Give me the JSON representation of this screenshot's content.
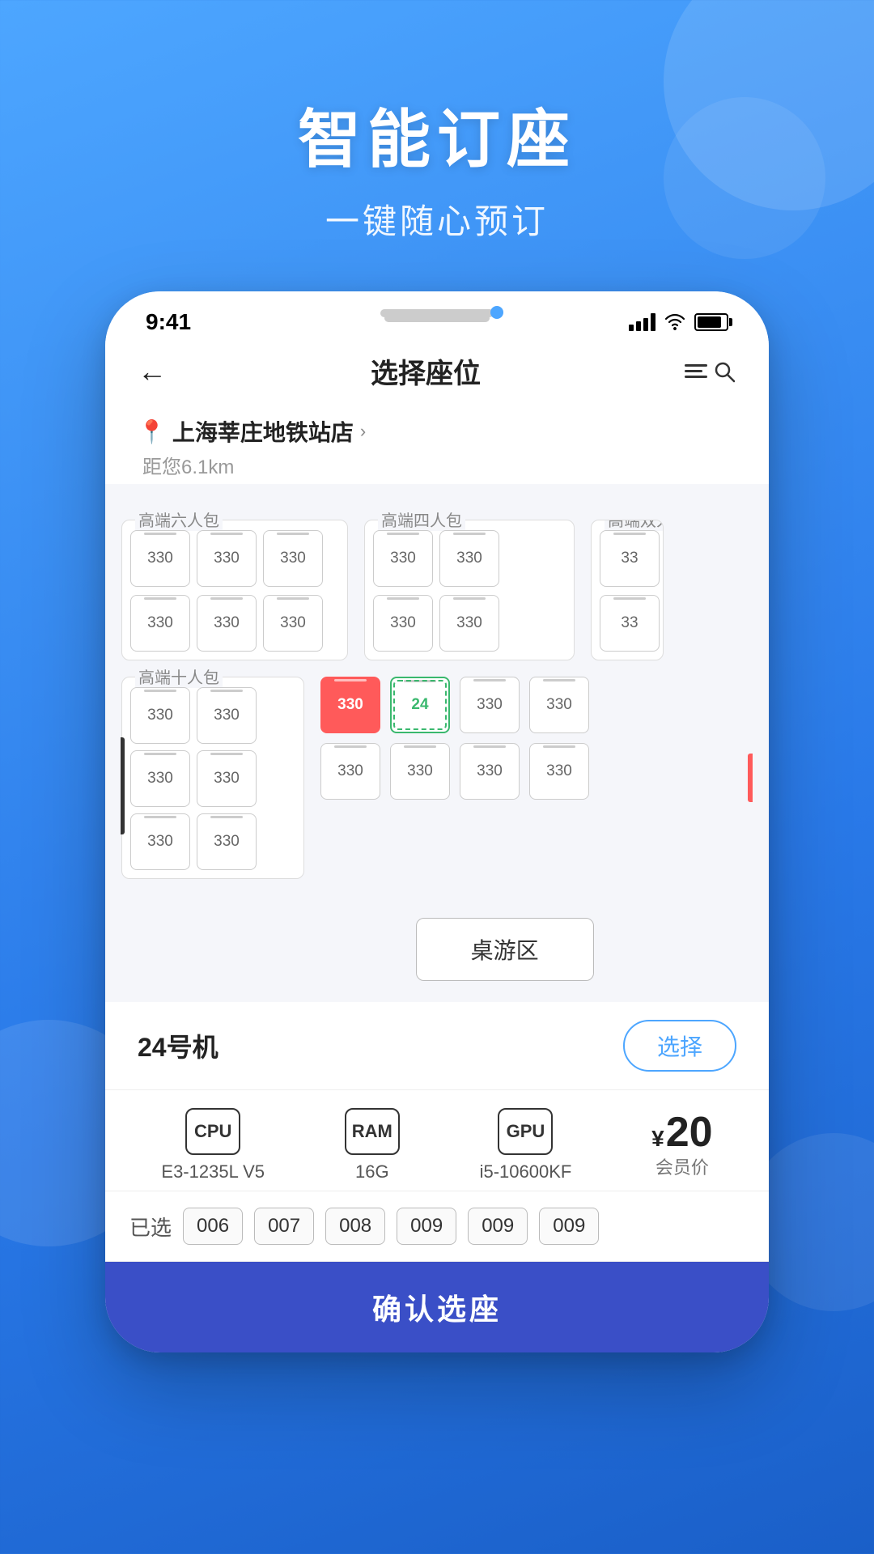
{
  "background": {
    "gradient_start": "#4da6ff",
    "gradient_end": "#1a5fc8"
  },
  "header": {
    "title": "智能订座",
    "subtitle": "一键随心预订"
  },
  "status_bar": {
    "time": "9:41",
    "signal": "4 bars",
    "wifi": "on",
    "battery": "full"
  },
  "app_bar": {
    "back_label": "←",
    "title": "选择座位",
    "filter_icon": "list-search"
  },
  "location": {
    "name": "上海莘庄地铁站店",
    "arrow": ">",
    "distance": "距您6.1km"
  },
  "seat_map": {
    "rooms": [
      {
        "id": "room-6",
        "label": "高端六人包",
        "seats": [
          "330",
          "330",
          "330",
          "330",
          "330",
          "330"
        ]
      },
      {
        "id": "room-4",
        "label": "高端四人包",
        "seats": [
          "330",
          "330",
          "330",
          "330"
        ]
      },
      {
        "id": "room-2",
        "label": "高端双人",
        "seats": [
          "33",
          "33"
        ]
      }
    ],
    "room_10": {
      "label": "高端十人包",
      "left_seats": [
        "330",
        "330",
        "330",
        "330",
        "330",
        "330"
      ],
      "right_seats_top": [
        "330",
        "24",
        "330",
        "330"
      ],
      "right_seats_bottom": [
        "330",
        "330",
        "330",
        "330"
      ],
      "occupied_seat": "330",
      "selected_seat": "24"
    },
    "table_game_zone": "桌游区"
  },
  "info_panel": {
    "machine_name": "24号机",
    "select_button": "选择"
  },
  "specs": [
    {
      "icon": "CPU",
      "label": "E3-1235L V5"
    },
    {
      "icon": "RAM",
      "label": "16G"
    },
    {
      "icon": "GPU",
      "label": "i5-10600KF"
    }
  ],
  "price": {
    "currency": "¥",
    "amount": "20",
    "label": "会员价"
  },
  "selected_seats": {
    "label": "已选",
    "seats": [
      "006",
      "007",
      "008",
      "009",
      "009",
      "009"
    ]
  },
  "confirm_button": "确认选座"
}
